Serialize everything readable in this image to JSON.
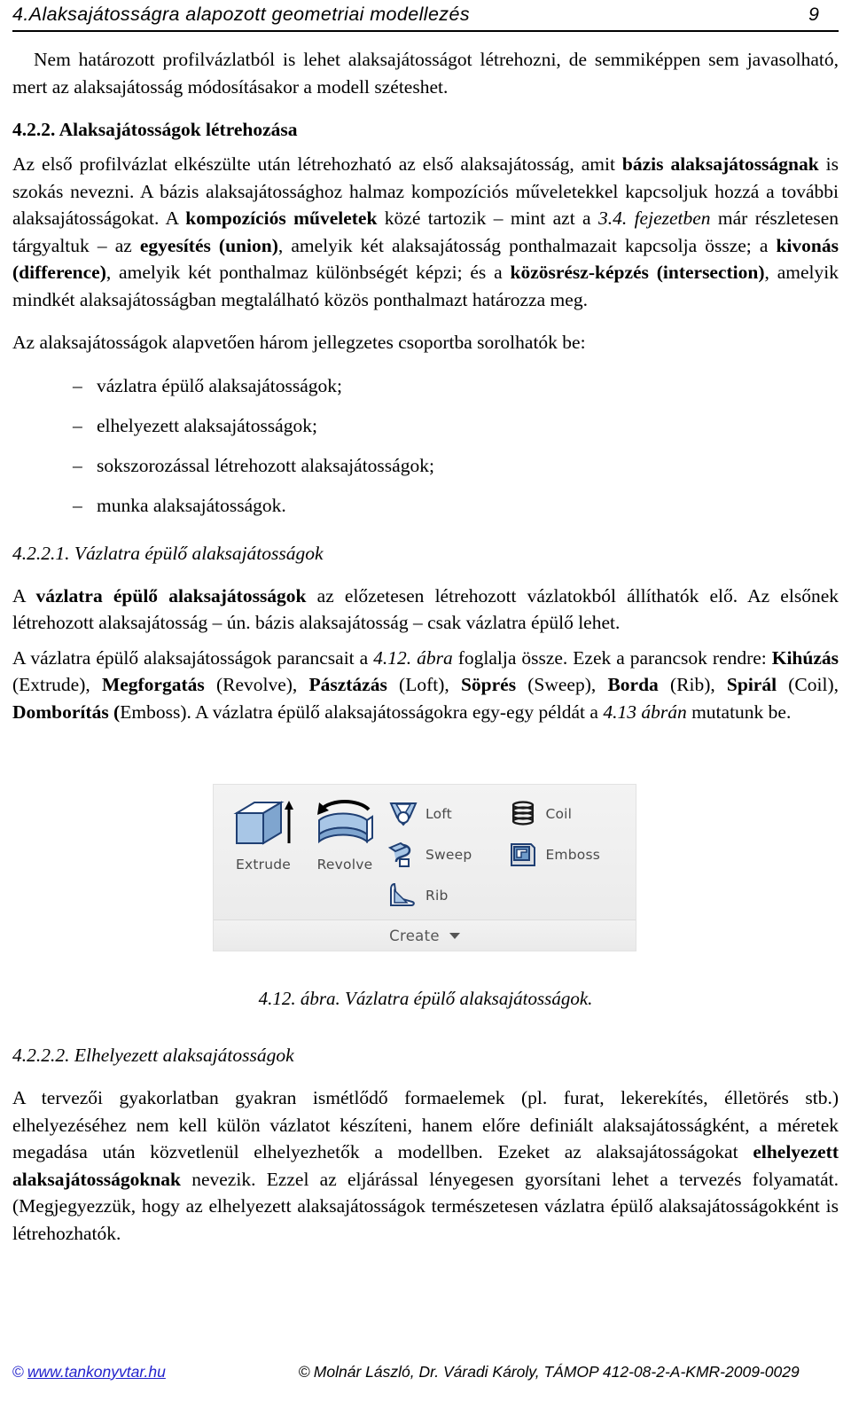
{
  "header": {
    "title": "4.Alaksajátosságra alapozott geometriai modellezés",
    "page_number": "9"
  },
  "body": {
    "intro_paragraph": "Nem határozott profilvázlatból is lehet alaksajátosságot létrehozni, de semmiképpen sem javasolható, mert az alaksajátosság módosításakor a modell széteshet.",
    "section_4_2_2": {
      "heading": "4.2.2. Alaksajátosságok létrehozása",
      "para_1_parts": {
        "a": "Az első profilvázlat elkészülte után létrehozható az első alaksajátosság, amit ",
        "b1": "bázis alaksajátosságnak",
        "c": " is szokás nevezni. A bázis alaksajátossághoz halmaz kompozíciós műveletekkel kapcsoljuk hozzá a további alaksajátosságokat. A ",
        "b2": "kompozíciós műveletek",
        "d": " közé tartozik – mint azt a ",
        "i1": "3.4. fejezetben",
        "e": " már részletesen tárgyaltuk – az ",
        "b3": "egyesítés (union)",
        "f": ", amelyik két alaksajátosság ponthalmazait kapcsolja össze; a ",
        "b4": "kivonás (difference)",
        "g": ", amelyik két ponthalmaz különbségét képzi; és a ",
        "b5": "közösrész-képzés (intersection)",
        "h": ", amelyik mindkét alaksajátosságban megtalálható közös ponthalmazt határozza meg."
      },
      "lead_in": "Az alaksajátosságok alapvetően három jellegzetes csoportba sorolhatók be:",
      "list_dash": "–",
      "list_items": [
        "vázlatra épülő alaksajátosságok;",
        "elhelyezett alaksajátosságok;",
        "sokszorozással létrehozott alaksajátosságok;",
        "munka alaksajátosságok."
      ]
    },
    "section_4_2_2_1": {
      "heading": "4.2.2.1. Vázlatra épülő alaksajátosságok",
      "para_1_parts": {
        "a": "A ",
        "b1": "vázlatra épülő alaksajátosságok",
        "c": " az előzetesen létrehozott vázlatokból állíthatók elő. Az elsőnek létrehozott alaksajátosság – ún. bázis alaksajátosság – csak vázlatra épülő lehet."
      },
      "para_2_parts": {
        "a": "A vázlatra épülő alaksajátosságok parancsait a ",
        "i1": "4.12. ábra",
        "b": " foglalja össze. Ezek a parancsok rendre: ",
        "b1": "Kihúzás",
        "n1": " (Extrude), ",
        "b2": "Megforgatás",
        "n2": " (Revolve), ",
        "b3": "Pásztázás",
        "n3": " (Loft), ",
        "b4": "Söprés",
        "n4": " (Sweep), ",
        "b5": "Borda",
        "n5": " (Rib), ",
        "b6": "Spirál",
        "n6": " (Coil), ",
        "b7": "Domborítás (",
        "n7": "Emboss). A vázlatra épülő alaksajátosságokra egy-egy példát a ",
        "i2": "4.13 ábrán",
        "z": " mutatunk be."
      }
    },
    "section_4_2_2_2": {
      "heading": "4.2.2.2. Elhelyezett alaksajátosságok",
      "para_1_parts": {
        "a": "A tervezői gyakorlatban gyakran ismétlődő formaelemek (pl. furat, lekerekítés, élletörés stb.) elhelyezéséhez nem kell külön vázlatot készíteni, hanem előre definiált alaksajátosságként, a méretek megadása után közvetlenül elhelyezhetők a modellben. Ezeket az alaksajátosságokat ",
        "b1": "elhelyezett alaksajátosságoknak",
        "c": " nevezik. Ezzel az eljárással lényegesen gyorsítani lehet a tervezés folyamatát. (Megjegyezzük, hogy az elhelyezett alaksajátosságok természetesen vázlatra épülő alaksajátosságokként is létrehozhatók."
      }
    }
  },
  "figure": {
    "caption": "4.12. ábra. Vázlatra épülő alaksajátosságok.",
    "panel_title": "Create",
    "large_buttons": [
      {
        "label": "Extrude",
        "icon": "extrude-icon"
      },
      {
        "label": "Revolve",
        "icon": "revolve-icon"
      }
    ],
    "small_buttons_col1": [
      {
        "label": "Loft",
        "icon": "loft-icon"
      },
      {
        "label": "Sweep",
        "icon": "sweep-icon"
      },
      {
        "label": "Rib",
        "icon": "rib-icon"
      }
    ],
    "small_buttons_col2": [
      {
        "label": "Coil",
        "icon": "coil-icon"
      },
      {
        "label": "Emboss",
        "icon": "emboss-icon"
      }
    ],
    "colors": {
      "panel_bg": "#eeeeee",
      "icon_fill": "#9cbcdd",
      "icon_stroke": "#1f3f73",
      "label_text": "#4a4a4a"
    }
  },
  "footer": {
    "copyright_symbol": "©",
    "left_url": "www.tankonyvtar.hu",
    "right_text": "Molnár László, Dr. Váradi Károly, TÁMOP 412-08-2-A-KMR-2009-0029",
    "link_color": "#2222cc"
  }
}
